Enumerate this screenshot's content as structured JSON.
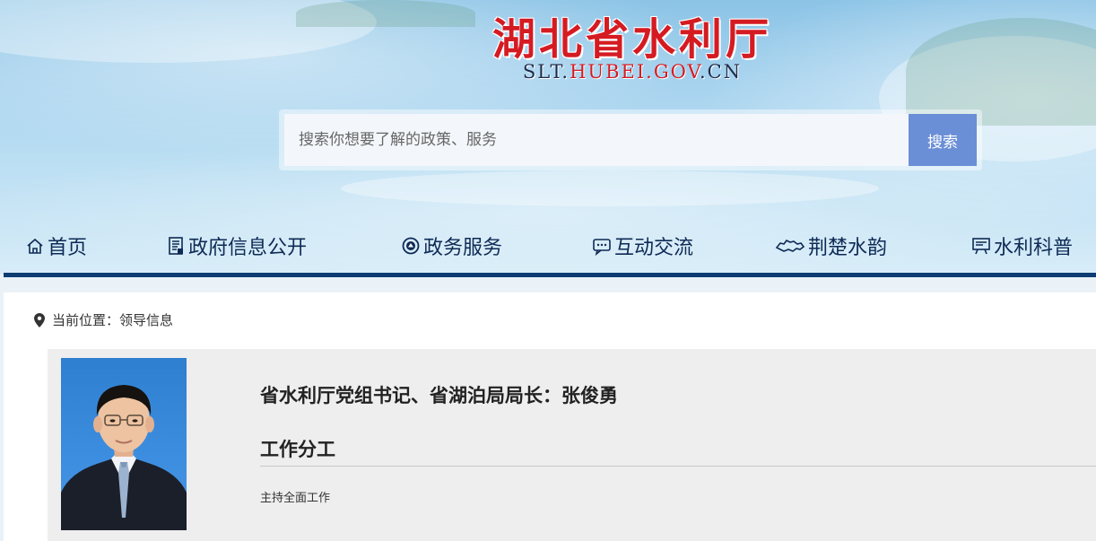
{
  "header": {
    "site_title": "湖北省水利厅",
    "domain_part1": "SLT.",
    "domain_part2": "HUBEI.GOV",
    "domain_part3": ".CN"
  },
  "search": {
    "placeholder": "搜索你想要了解的政策、服务",
    "button_label": "搜索"
  },
  "nav": {
    "items": [
      {
        "label": "首页",
        "icon": "home-icon"
      },
      {
        "label": "政府信息公开",
        "icon": "document-icon"
      },
      {
        "label": "政务服务",
        "icon": "service-badge-icon"
      },
      {
        "label": "互动交流",
        "icon": "chat-bubble-icon"
      },
      {
        "label": "荆楚水韵",
        "icon": "province-map-icon"
      },
      {
        "label": "水利科普",
        "icon": "display-board-icon"
      }
    ]
  },
  "breadcrumb": {
    "label": "当前位置：",
    "current": "领导信息"
  },
  "leader": {
    "title": "省水利厅党组书记、省湖泊局局长：张俊勇",
    "section_title": "工作分工",
    "duty": "主持全面工作"
  },
  "colors": {
    "title_red": "#d51b22",
    "nav_text": "#0e2a55",
    "nav_rule": "#0d3c73",
    "search_button": "#6a8fd6"
  }
}
